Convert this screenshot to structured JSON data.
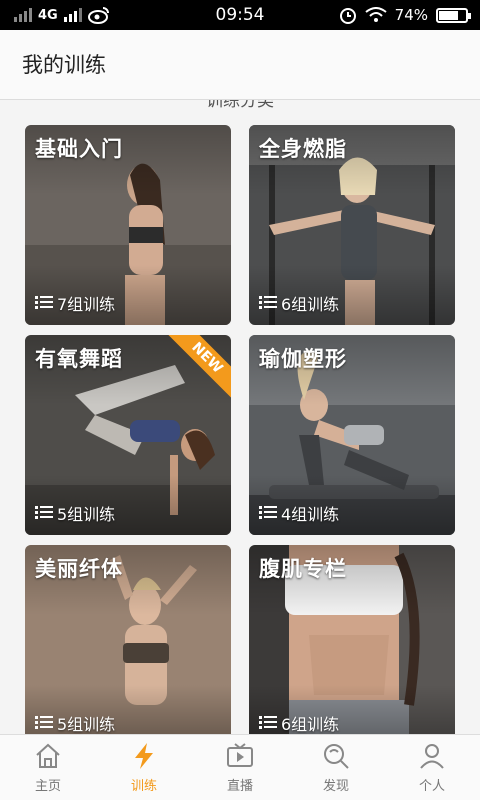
{
  "status_bar": {
    "network": "4G",
    "time": "09:54",
    "battery": "74%",
    "battery_level": 0.74
  },
  "header": {
    "title": "我的训练"
  },
  "section_title": "训练分类",
  "cards": [
    {
      "title": "基础入门",
      "count": "7组训练"
    },
    {
      "title": "全身燃脂",
      "count": "6组训练"
    },
    {
      "title": "有氧舞蹈",
      "count": "5组训练",
      "badge": "NEW"
    },
    {
      "title": "瑜伽塑形",
      "count": "4组训练"
    },
    {
      "title": "美丽纤体",
      "count": "5组训练"
    },
    {
      "title": "腹肌专栏",
      "count": "6组训练"
    }
  ],
  "tabs": [
    {
      "label": "主页",
      "icon": "home-icon"
    },
    {
      "label": "训练",
      "icon": "lightning-icon",
      "active": true
    },
    {
      "label": "直播",
      "icon": "tv-play-icon"
    },
    {
      "label": "发现",
      "icon": "discover-icon"
    },
    {
      "label": "个人",
      "icon": "person-icon"
    }
  ],
  "colors": {
    "accent": "#f39a1c"
  }
}
